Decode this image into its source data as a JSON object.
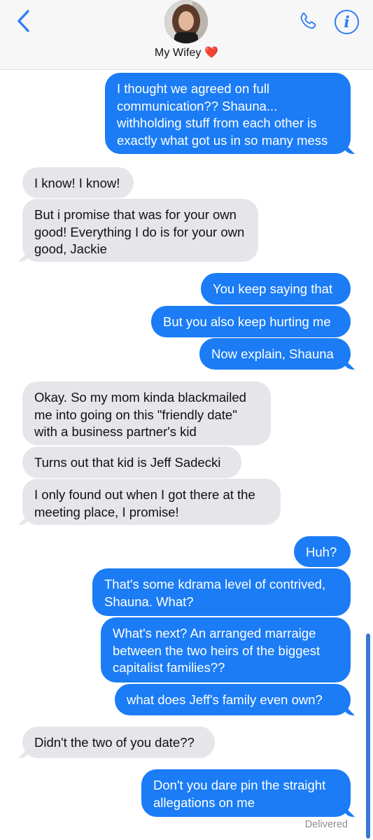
{
  "header": {
    "contact_name": "My Wifey",
    "contact_emoji": "❤️",
    "icons": {
      "back": "chevron-left-icon",
      "phone": "phone-icon",
      "info": "info-icon"
    },
    "accent_color": "#2f7cf6"
  },
  "messages": [
    {
      "side": "sent",
      "text": "I thought we agreed on full\ncommunication?? Shauna...\nwithholding stuff from each other is\nexactly what got us in so many mess"
    },
    {
      "side": "received",
      "text": "I know! I know!"
    },
    {
      "side": "received",
      "text": "But i promise that was for your own\ngood! Everything I do is for your own\ngood, Jackie"
    },
    {
      "side": "sent",
      "text": "You keep saying that"
    },
    {
      "side": "sent",
      "text": "But you also keep hurting me"
    },
    {
      "side": "sent",
      "text": "Now explain, Shauna"
    },
    {
      "side": "received",
      "text": "Okay. So my mom kinda blackmailed\nme into going on this \"friendly date\"\nwith a business partner's kid"
    },
    {
      "side": "received",
      "text": "Turns out that kid is Jeff Sadecki"
    },
    {
      "side": "received",
      "text": "I only found out when I got there at the\nmeeting place, I promise!"
    },
    {
      "side": "sent",
      "text": "Huh?"
    },
    {
      "side": "sent",
      "text": "That's some kdrama level of contrived,\nShauna. What?"
    },
    {
      "side": "sent",
      "text": "What's next? An arranged marraige\nbetween the two heirs of the biggest\ncapitalist families??"
    },
    {
      "side": "sent",
      "text": "what does Jeff's family even own?"
    },
    {
      "side": "received",
      "text": "Didn't the two of you date??"
    },
    {
      "side": "sent",
      "text": "Don't you dare pin the straight\nallegations on me"
    }
  ],
  "status": {
    "delivered": "Delivered"
  },
  "colors": {
    "sent_bubble": "#1b7cf5",
    "received_bubble": "#e6e5ea"
  }
}
